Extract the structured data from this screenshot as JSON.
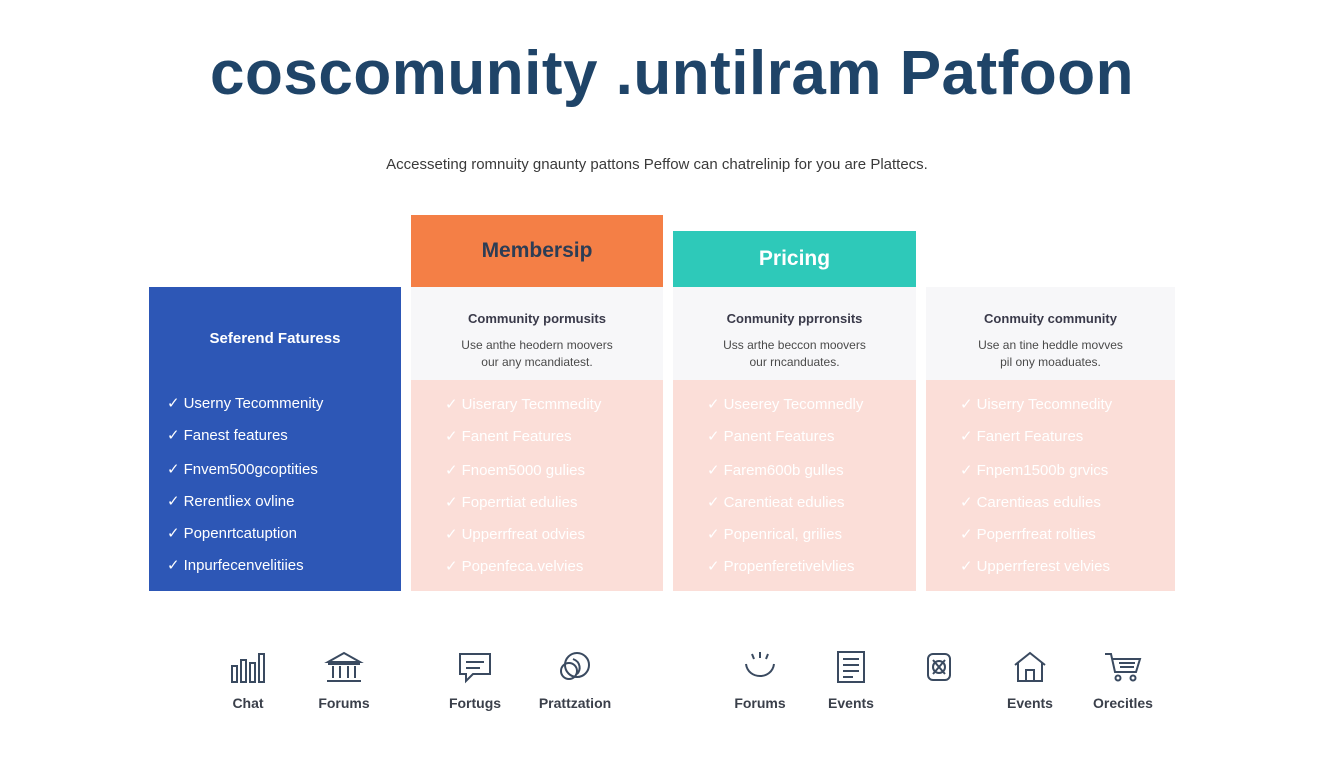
{
  "header": {
    "title": "coscomunity .untilram Patfoon",
    "subtitle": "Accesseting romnuity gnaunty pattons Peffow can chatrelinip for you are Plattecs."
  },
  "colors": {
    "title": "#1f4468",
    "features_bg": "#2d57b6",
    "membership_bg": "#f47f46",
    "pricing_bg": "#2ec9b9",
    "plan_body_bg": "#fbded8"
  },
  "columns": {
    "membership_header": "Membersip",
    "pricing_header": "Pricing",
    "features": {
      "title": "Seferend Faturess",
      "items": [
        "Userny Tecommenity",
        "Fanest features",
        "Fnvem500gcoptities",
        "Rerentliex ovline",
        "Popenrtcatuption",
        "Inpurfecenvelitiies"
      ]
    },
    "plans": [
      {
        "title": "Community pormusits",
        "desc_line1": "Use anthe heodern moovers",
        "desc_line2": "our any mcandiatest.",
        "items": [
          "Uiserary Tecmmedity",
          "Fanent Features",
          "Fnoem5000 gulies",
          "Foperrtiat edulies",
          "Upperrfreat odvies",
          "Popenfeca.velvies"
        ]
      },
      {
        "title": "Conmunity pprronsits",
        "desc_line1": "Uss arthe beccon moovers",
        "desc_line2": "our rncanduates.",
        "items": [
          "Useerey Tecomnedly",
          "Panent Features",
          "Farem600b gulles",
          "Carentieat edulies",
          "Popenrical, grilies",
          "Propenferetivelvlies"
        ]
      },
      {
        "title": "Conmuity community",
        "desc_line1": "Use an tine heddle movves",
        "desc_line2": "pil ony moaduates.",
        "items": [
          "Uiserry Tecomnedity",
          "Fanert Features",
          "Fnpem1500b grvics",
          "Carentieas edulies",
          "Poperrfreat rolties",
          "Upperrferest velvies"
        ]
      }
    ]
  },
  "icons": [
    {
      "name": "bar-chart-icon",
      "label": "Chat"
    },
    {
      "name": "building-icon",
      "label": "Forums"
    },
    {
      "name": "chat-bubble-icon",
      "label": "Fortugs"
    },
    {
      "name": "globe-icon",
      "label": "Prattzation"
    },
    {
      "name": "smile-icon",
      "label": "Forums"
    },
    {
      "name": "document-icon",
      "label": "Events"
    },
    {
      "name": "emblem-icon",
      "label": ""
    },
    {
      "name": "house-icon",
      "label": "Events"
    },
    {
      "name": "cart-icon",
      "label": "Orecitles"
    }
  ]
}
